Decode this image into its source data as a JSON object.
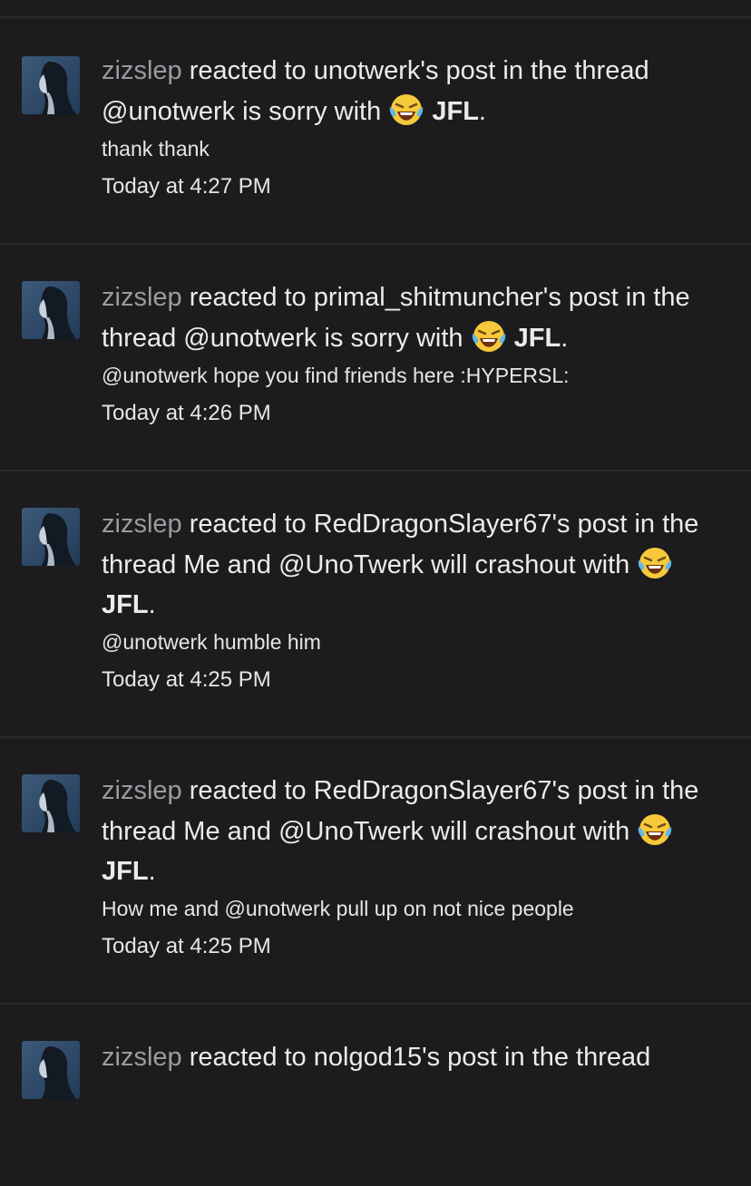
{
  "alerts": [
    {
      "username": "zizslep",
      "text_before": " reacted to unotwerk's post in the thread @unotwerk is sorry with ",
      "reaction": "JFL",
      "text_after": ".",
      "snippet": "thank thank",
      "time": "Today at 4:27 PM"
    },
    {
      "username": "zizslep",
      "text_before": " reacted to primal_shitmuncher's post in the thread @unotwerk is sorry with ",
      "reaction": "JFL",
      "text_after": ".",
      "snippet": "@unotwerk hope you find friends here :HYPERSL:",
      "time": "Today at 4:26 PM"
    },
    {
      "username": "zizslep",
      "text_before": " reacted to RedDragonSlayer67's post in the thread Me and @UnoTwerk will crashout with ",
      "reaction": "JFL",
      "text_after": ".",
      "snippet": "@unotwerk humble him",
      "time": "Today at 4:25 PM"
    },
    {
      "username": "zizslep",
      "text_before": " reacted to RedDragonSlayer67's post in the thread Me and @UnoTwerk will crashout with ",
      "reaction": "JFL",
      "text_after": ".",
      "snippet": "How me and @unotwerk pull up on not nice people",
      "time": "Today at 4:25 PM"
    },
    {
      "username": "zizslep",
      "text_before": " reacted to nolgod15's post in the thread",
      "reaction": "",
      "text_after": "",
      "snippet": "",
      "time": ""
    }
  ],
  "icons": {
    "avatar": "user-avatar",
    "reaction": "crying-laughing-emoji-icon"
  },
  "colors": {
    "background": "#1c1c1e",
    "divider": "#2b2b2d",
    "username": "#9b9b9f",
    "text": "#ebebeb"
  }
}
